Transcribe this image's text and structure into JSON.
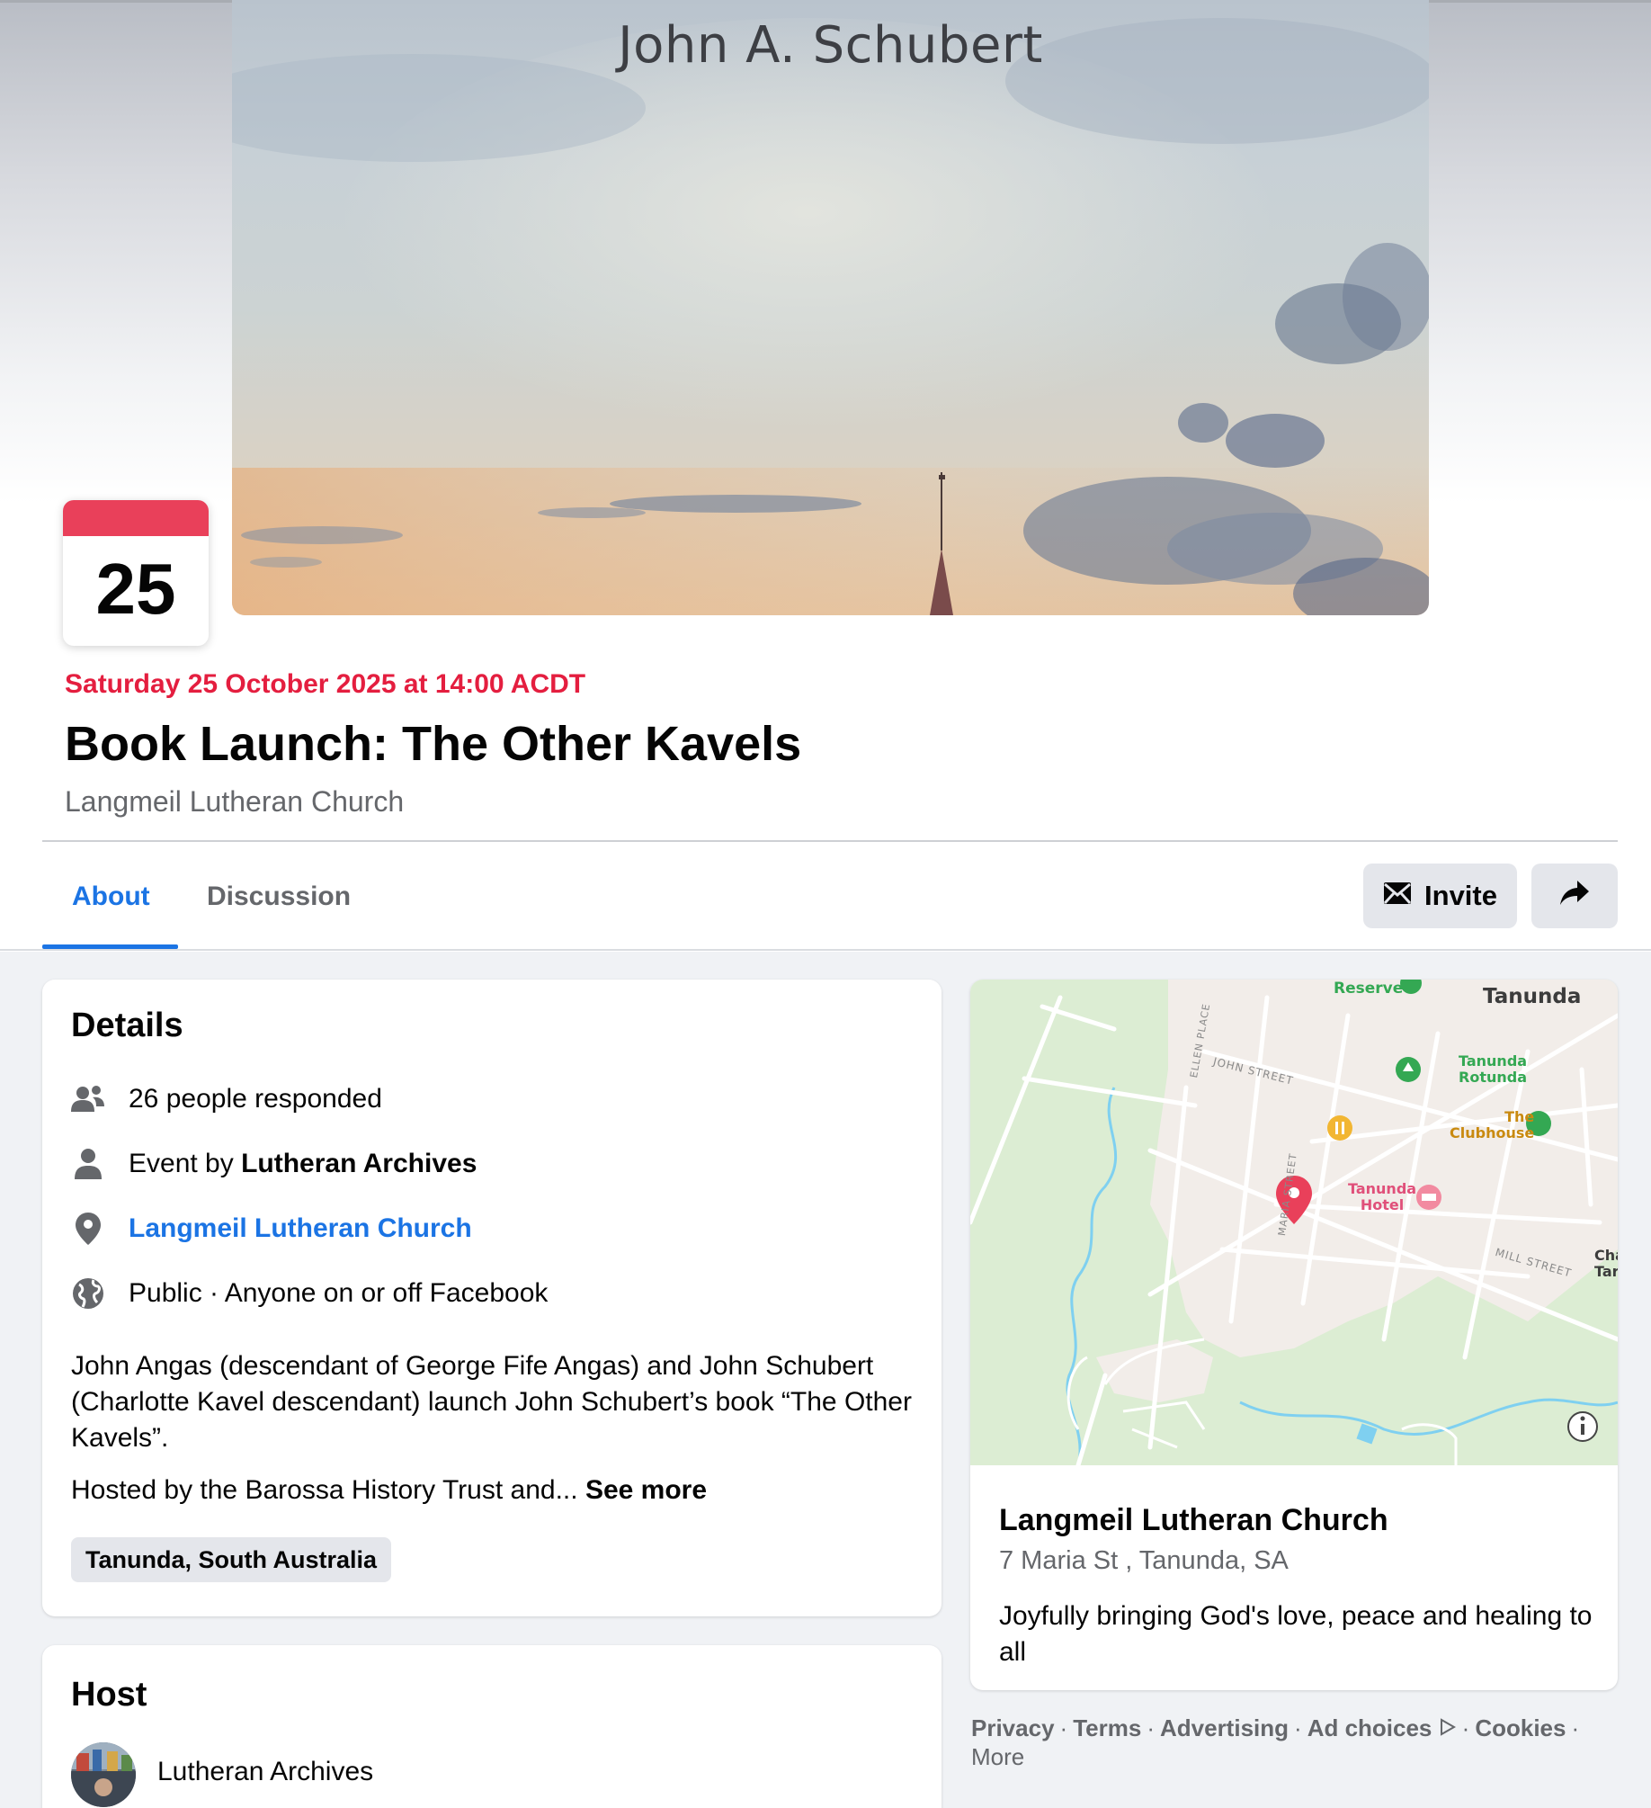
{
  "cover": {
    "author_text": "John A. Schubert"
  },
  "calendar": {
    "day": "25"
  },
  "event": {
    "datetime": "Saturday 25 October 2025 at 14:00 ACDT",
    "title": "Book Launch: The Other Kavels",
    "venue": "Langmeil Lutheran Church"
  },
  "tabs": [
    {
      "label": "About",
      "active": true
    },
    {
      "label": "Discussion",
      "active": false
    }
  ],
  "actions": {
    "invite_label": "Invite",
    "share_icon": "share-arrow-icon"
  },
  "details": {
    "heading": "Details",
    "responded": "26 people responded",
    "event_by_prefix": "Event by",
    "event_by_name": "Lutheran Archives",
    "location_link": "Langmeil Lutheran Church",
    "privacy": "Public · Anyone on or off Facebook",
    "description_1": "John Angas (descendant of George Fife Angas) and John Schubert (Charlotte Kavel descendant) launch John Schubert’s book “The Other Kavels”.",
    "description_2": "Hosted by the Barossa History Trust and...",
    "see_more": "See more",
    "location_chip": "Tanunda, South Australia"
  },
  "host": {
    "heading": "Host",
    "name": "Lutheran Archives"
  },
  "map": {
    "labels": {
      "reserve": "Reserve",
      "tanunda": "Tanunda",
      "rotunda_1": "Tanunda",
      "rotunda_2": "Rotunda",
      "clubhouse_1": "The",
      "clubhouse_2": "Clubhouse",
      "hotel_1": "Tanunda",
      "hotel_2": "Hotel",
      "john_street": "JOHN STREET",
      "ellen_place": "ELLEN PLACE",
      "maria_street": "MARIA STREET",
      "mill_street": "MILL STREET",
      "edge_1": "Cha",
      "edge_2": "Tar"
    },
    "colors": {
      "land": "#f2ede9",
      "park": "#dcedd3",
      "water": "#7fd0f0",
      "pin": "#e9405a"
    }
  },
  "location_card": {
    "name": "Langmeil Lutheran Church",
    "address": "7 Maria St , Tanunda, SA",
    "description": "Joyfully bringing God's love, peace and healing to all"
  },
  "footer": {
    "privacy": "Privacy",
    "terms": "Terms",
    "advertising": "Advertising",
    "ad_choices": "Ad choices",
    "cookies": "Cookies",
    "more": "More",
    "separator": "·"
  }
}
